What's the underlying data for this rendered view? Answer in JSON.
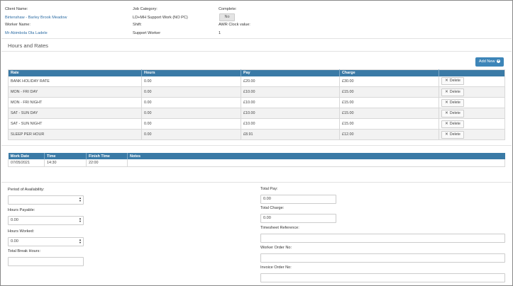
{
  "header": {
    "client_label": "Client Name:",
    "client_value": "Birtenshaw - Barley Brook Meadow",
    "job_category_label": "Job Category:",
    "job_category_value": "LD+MH Support Work (NO PC)",
    "complete_label": "Complete:",
    "complete_toggle": "No",
    "worker_label": "Worker Name:",
    "worker_value": "Mr Abimbola Ola Ladele",
    "shift_label": "Shift:",
    "shift_value": "Support Worker",
    "awr_label": "AWR Clock value:",
    "awr_value": "1"
  },
  "hours_rates": {
    "title": "Hours and Rates",
    "add_button": "Add New",
    "columns": [
      "Rate",
      "Hours",
      "Pay",
      "Charge",
      ""
    ],
    "delete_label": "Delete",
    "rows": [
      {
        "rate": "BANK HOLIDAY RATE",
        "hours": "0.00",
        "pay": "£20.00",
        "charge": "£30.00"
      },
      {
        "rate": "MON - FRI DAY",
        "hours": "0.00",
        "pay": "£10.00",
        "charge": "£15.00"
      },
      {
        "rate": "MON - FRI NIGHT",
        "hours": "0.00",
        "pay": "£10.00",
        "charge": "£15.00"
      },
      {
        "rate": "SAT - SUN DAY",
        "hours": "0.00",
        "pay": "£10.00",
        "charge": "£15.00"
      },
      {
        "rate": "SAT - SUN NIGHT",
        "hours": "0.00",
        "pay": "£10.00",
        "charge": "£15.00"
      },
      {
        "rate": "SLEEP PER HOUR",
        "hours": "0.00",
        "pay": "£8.91",
        "charge": "£12.00"
      }
    ]
  },
  "work": {
    "columns": [
      "Work Date",
      "Time",
      "Finish Time",
      "Notes"
    ],
    "rows": [
      {
        "date": "07/05/2021",
        "time": "14:30",
        "finish": "22:00",
        "notes": ""
      }
    ]
  },
  "form": {
    "period_label": "Period of Availability:",
    "period_value": "",
    "hours_payable_label": "Hours Payable:",
    "hours_payable_value": "0.00",
    "hours_worked_label": "Hours Worked:",
    "hours_worked_value": "0.00",
    "total_break_label": "Total Break Hours:",
    "total_break_value": "",
    "total_pay_label": "Total Pay:",
    "total_pay_value": "0.00",
    "total_charge_label": "Total Charge:",
    "total_charge_value": "0.00",
    "timesheet_ref_label": "Timesheet Reference:",
    "timesheet_ref_value": "",
    "worker_order_label": "Worker Order No:",
    "worker_order_value": "",
    "invoice_order_label": "Invoice Order No:",
    "invoice_order_value": ""
  }
}
